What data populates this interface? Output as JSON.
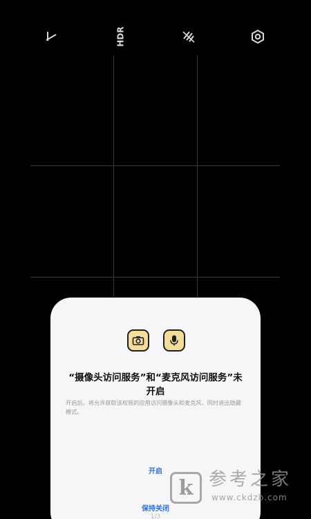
{
  "toolbar": {
    "flash_icon": "flash-off-icon",
    "hdr_label": "HDR",
    "ai_icon": "ai-off-icon",
    "settings_icon": "settings-icon"
  },
  "dialog": {
    "icons": [
      "camera-icon",
      "microphone-icon"
    ],
    "title": "“摄像头访问服务”和“麦克风访问服务”未开启",
    "description": "开启后，将允许获取该权限的应用访问摄像头和麦克风，同时退出隐藏模式。",
    "enable_label": "开启",
    "keep_off_label": "保持关闭",
    "page_indicator": "1/3"
  },
  "watermark": {
    "mark": "k",
    "title": "参考之家",
    "url": "www.ckdzb.com"
  },
  "colors": {
    "background": "#000000",
    "dialog_background": "#f6f6f8",
    "accent": "#2f6fd6",
    "icon_fill": "#f4dc9a"
  }
}
